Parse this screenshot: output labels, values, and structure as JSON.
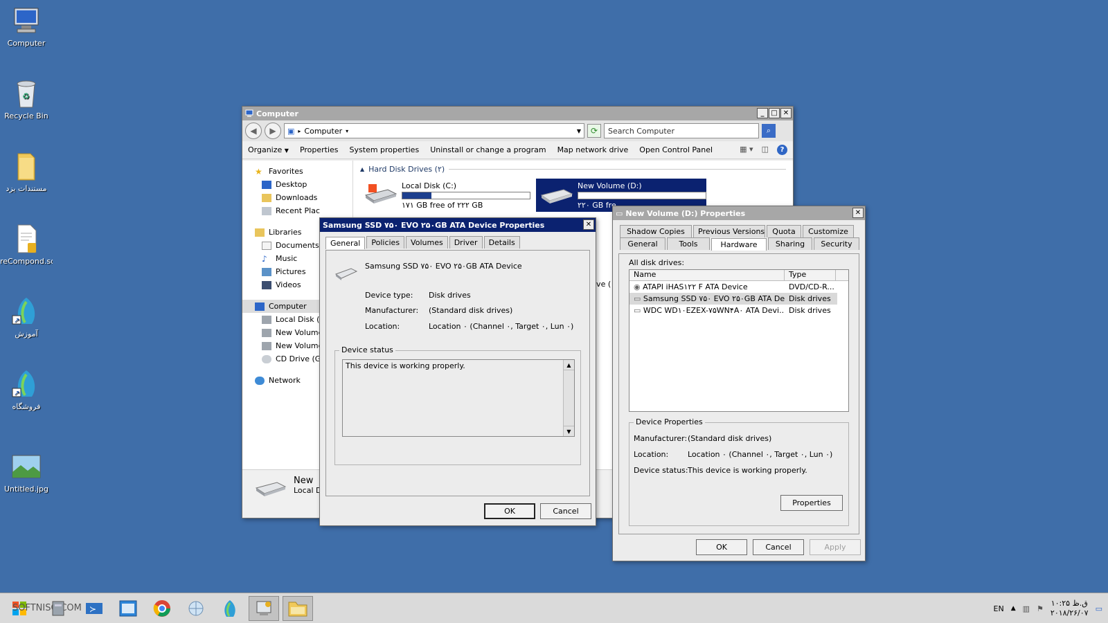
{
  "desktop": {
    "icons": [
      {
        "label": "Computer"
      },
      {
        "label": "Recycle Bin"
      },
      {
        "label": "مستندات یزد"
      },
      {
        "label": "reCompond.sql"
      },
      {
        "label": "آموزش"
      },
      {
        "label": "فروشگاه"
      },
      {
        "label": "Untitled.jpg"
      }
    ]
  },
  "explorer": {
    "title": "Computer",
    "address": "Computer",
    "search_placeholder": "Search Computer",
    "commands": [
      "Organize",
      "Properties",
      "System properties",
      "Uninstall or change a program",
      "Map network drive",
      "Open Control Panel"
    ],
    "nav": {
      "favorites": "Favorites",
      "desktop": "Desktop",
      "downloads": "Downloads",
      "recent": "Recent Plac",
      "libraries": "Libraries",
      "documents": "Documents",
      "music": "Music",
      "pictures": "Pictures",
      "videos": "Videos",
      "computer": "Computer",
      "local_disk": "Local Disk (C",
      "new_volume_1": "New Volume",
      "new_volume_2": "New Volume",
      "cd_drive": "CD Drive (G",
      "network": "Network"
    },
    "group_header": "Hard Disk Drives (۲)",
    "drives": [
      {
        "name": "Local Disk (C:)",
        "free": "۱۷۱ GB free of ۲۲۲ GB",
        "used_fraction": 0.23
      },
      {
        "name": "New Volume (D:)",
        "free": "۲۲۰ GB fre",
        "used_fraction": 0.1
      }
    ],
    "partial_text": "ive (",
    "details": {
      "name": "New ",
      "type": "Local D"
    }
  },
  "device_dialog": {
    "title": "Samsung SSD ۷۵۰ EVO ۲۵۰GB ATA Device Properties",
    "tabs": [
      "General",
      "Policies",
      "Volumes",
      "Driver",
      "Details"
    ],
    "device_name": "Samsung SSD ۷۵۰ EVO ۲۵۰GB ATA Device",
    "device_type_label": "Device type:",
    "device_type": "Disk drives",
    "manufacturer_label": "Manufacturer:",
    "manufacturer": "(Standard disk drives)",
    "location_label": "Location:",
    "location": "Location ۰ (Channel ۰, Target ۰, Lun ۰)",
    "status_legend": "Device status",
    "status_text": "This device is working properly.",
    "ok": "OK",
    "cancel": "Cancel"
  },
  "volume_dialog": {
    "title": "New Volume (D:) Properties",
    "tabs_row1": [
      "Shadow Copies",
      "Previous Versions",
      "Quota",
      "Customize"
    ],
    "tabs_row2": [
      "General",
      "Tools",
      "Hardware",
      "Sharing",
      "Security"
    ],
    "all_disks_label": "All disk drives:",
    "columns": [
      "Name",
      "Type"
    ],
    "rows": [
      {
        "name": "ATAPI iHAS۱۲۲   F ATA Device",
        "type": "DVD/CD-R..."
      },
      {
        "name": "Samsung SSD ۷۵۰ EVO ۲۵۰GB ATA De...",
        "type": "Disk drives"
      },
      {
        "name": "WDC WD۱۰EZEX-۷۵WN۴A۰ ATA Devi...",
        "type": "Disk drives"
      }
    ],
    "props_legend": "Device Properties",
    "manufacturer_label": "Manufacturer:",
    "manufacturer": "(Standard disk drives)",
    "location_label": "Location:",
    "location": "Location ۰ (Channel ۰, Target ۰, Lun ۰)",
    "status_label": "Device status:",
    "status": "This device is working properly.",
    "properties_btn": "Properties",
    "ok": "OK",
    "cancel": "Cancel",
    "apply": "Apply"
  },
  "taskbar": {
    "watermark": "SOFTNISO.COM",
    "lang": "EN",
    "time": "۱۰:۲۵ ق.ظ",
    "date": "۲۰۱۸/۲۶/۰۷"
  },
  "colors": {
    "desktop": "#3f6ea9",
    "active_title": "#0b2270",
    "inactive_title": "#a7a7a7",
    "drive_bar": "#1d3f8d"
  }
}
